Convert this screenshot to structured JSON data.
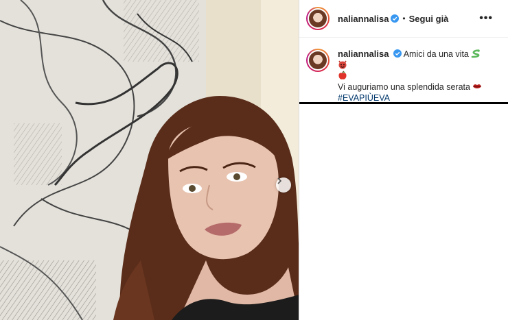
{
  "post": {
    "username": "naliannalisa",
    "follow_label": "Segui già",
    "separator": "•",
    "more_label": "•••",
    "caption_line1": "Amici da una vita",
    "caption_line2": "Vi auguriamo una splendida serata",
    "hashtag": "#EVAPIÙEVA"
  },
  "colors": {
    "verified": "#3897f0",
    "hashtag": "#00376b"
  },
  "icons": {
    "caption_emojis": [
      "snake-emoji",
      "devil-emoji",
      "apple-emoji"
    ],
    "lips": "lips-emoji",
    "carousel_next": "chevron-right-icon"
  }
}
